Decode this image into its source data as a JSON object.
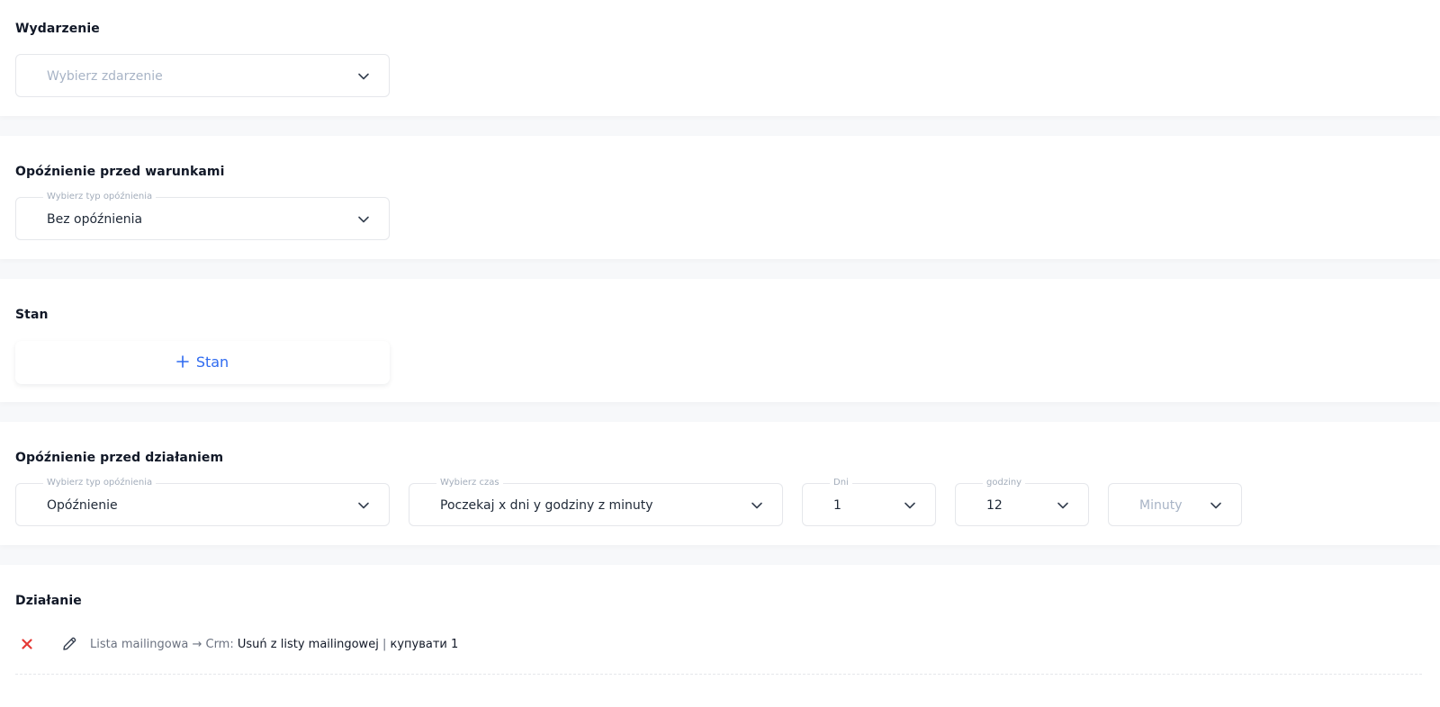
{
  "sections": {
    "event": {
      "title": "Wydarzenie",
      "select": {
        "placeholder": "Wybierz zdarzenie"
      }
    },
    "delay_before_conditions": {
      "title": "Opóźnienie przed warunkami",
      "select": {
        "label": "Wybierz typ opóźnienia",
        "value": "Bez opóźnienia"
      }
    },
    "condition": {
      "title": "Stan",
      "add_button": {
        "label": "Stan"
      }
    },
    "delay_before_action": {
      "title": "Opóźnienie przed działaniem",
      "type_select": {
        "label": "Wybierz typ opóźnienia",
        "value": "Opóźnienie"
      },
      "time_select": {
        "label": "Wybierz czas",
        "value": "Poczekaj x dni y godziny z minuty"
      },
      "days_select": {
        "label": "Dni",
        "value": "1"
      },
      "hours_select": {
        "label": "godziny",
        "value": "12"
      },
      "minutes_select": {
        "placeholder": "Minuty"
      }
    },
    "action": {
      "title": "Działanie",
      "row": {
        "prefix": "Lista mailingowa → Crm:",
        "action_name": "Usuń z listy mailingowej",
        "separator": "|",
        "target": "купувати 1"
      }
    }
  },
  "icons": {
    "chevron": "chevron-down-icon",
    "plus": "plus-icon",
    "remove": "close-icon",
    "edit": "pencil-icon"
  },
  "colors": {
    "accent": "#2f6bf0",
    "danger": "#e53935",
    "placeholder": "#a8b4c6",
    "label": "#a3adbb"
  }
}
